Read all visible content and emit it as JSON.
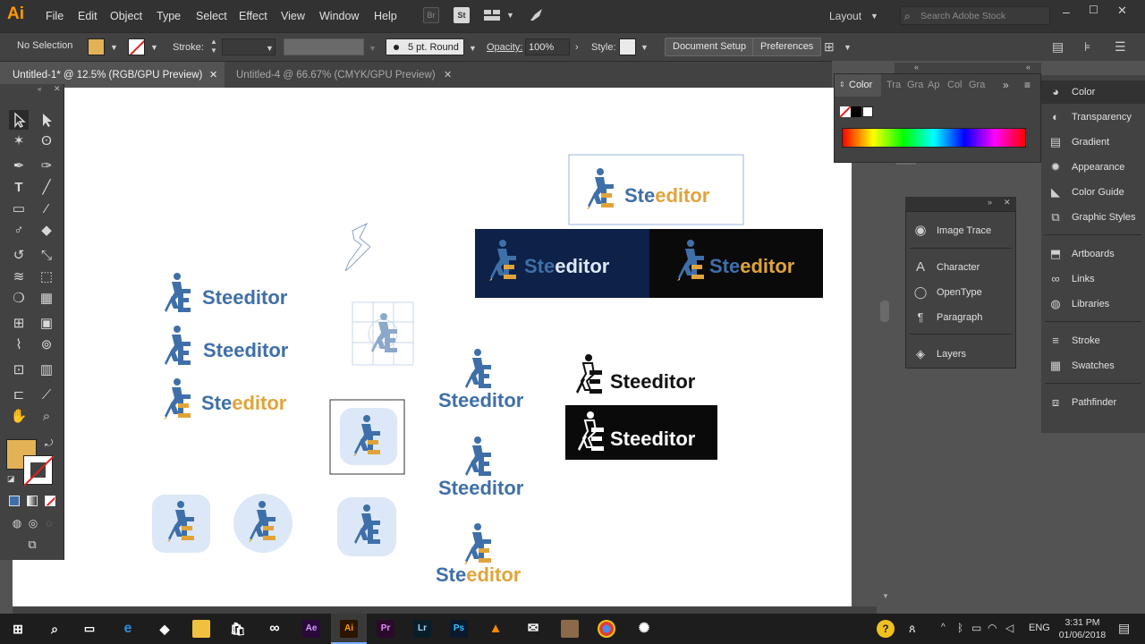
{
  "app": {
    "logo": "Ai",
    "menu": [
      "File",
      "Edit",
      "Object",
      "Type",
      "Select",
      "Effect",
      "View",
      "Window",
      "Help"
    ],
    "workspace": "Layout",
    "search_placeholder": "Search Adobe Stock",
    "bridge_icon": "Br",
    "stock_icon": "St"
  },
  "controlbar": {
    "selection": "No Selection",
    "stroke_label": "Stroke:",
    "brush": "5 pt. Round",
    "opacity_label": "Opacity:",
    "opacity_value": "100%",
    "style_label": "Style:",
    "document_setup": "Document Setup",
    "preferences": "Preferences"
  },
  "tabs": [
    {
      "label": "Untitled-1* @ 12.5% (RGB/GPU Preview)",
      "active": true
    },
    {
      "label": "Untitled-4 @ 66.67% (CMYK/GPU Preview)",
      "active": false
    }
  ],
  "colors": {
    "fill": "#e3b257",
    "logo_blue": "#3f6fa8",
    "logo_gold": "#e0a43a",
    "navy_bg": "#0e2148",
    "canvas_bg": "#ffffff"
  },
  "color_panel": {
    "tabs": [
      "Color",
      "Tra",
      "Gra",
      "Ap",
      "Col",
      "Gra"
    ]
  },
  "mid_panel": {
    "items": [
      {
        "label": "Image Trace",
        "icon": "image-trace-icon"
      },
      {
        "label": "Character",
        "icon": "character-icon"
      },
      {
        "label": "OpenType",
        "icon": "opentype-icon"
      },
      {
        "label": "Paragraph",
        "icon": "paragraph-icon"
      },
      {
        "label": "Layers",
        "icon": "layers-icon"
      }
    ]
  },
  "right_dock": {
    "items": [
      {
        "label": "Color",
        "icon": "color-icon"
      },
      {
        "label": "Transparency",
        "icon": "transparency-icon"
      },
      {
        "label": "Gradient",
        "icon": "gradient-icon"
      },
      {
        "label": "Appearance",
        "icon": "appearance-icon"
      },
      {
        "label": "Color Guide",
        "icon": "color-guide-icon"
      },
      {
        "label": "Graphic Styles",
        "icon": "graphic-styles-icon"
      },
      {
        "label": "Artboards",
        "icon": "artboards-icon"
      },
      {
        "label": "Links",
        "icon": "links-icon"
      },
      {
        "label": "Libraries",
        "icon": "libraries-icon"
      },
      {
        "label": "Stroke",
        "icon": "stroke-icon"
      },
      {
        "label": "Swatches",
        "icon": "swatches-icon"
      },
      {
        "label": "Pathfinder",
        "icon": "pathfinder-icon"
      }
    ]
  },
  "artwork": {
    "wordmark_ste": "Ste",
    "wordmark_editor": "editor",
    "wordmark_full": "Steeditor"
  },
  "taskbar": {
    "time": "3:31 PM",
    "date": "01/06/2018",
    "lang": "ENG",
    "apps": [
      "Ae",
      "Ai",
      "Pr",
      "Lr",
      "Ps"
    ]
  }
}
